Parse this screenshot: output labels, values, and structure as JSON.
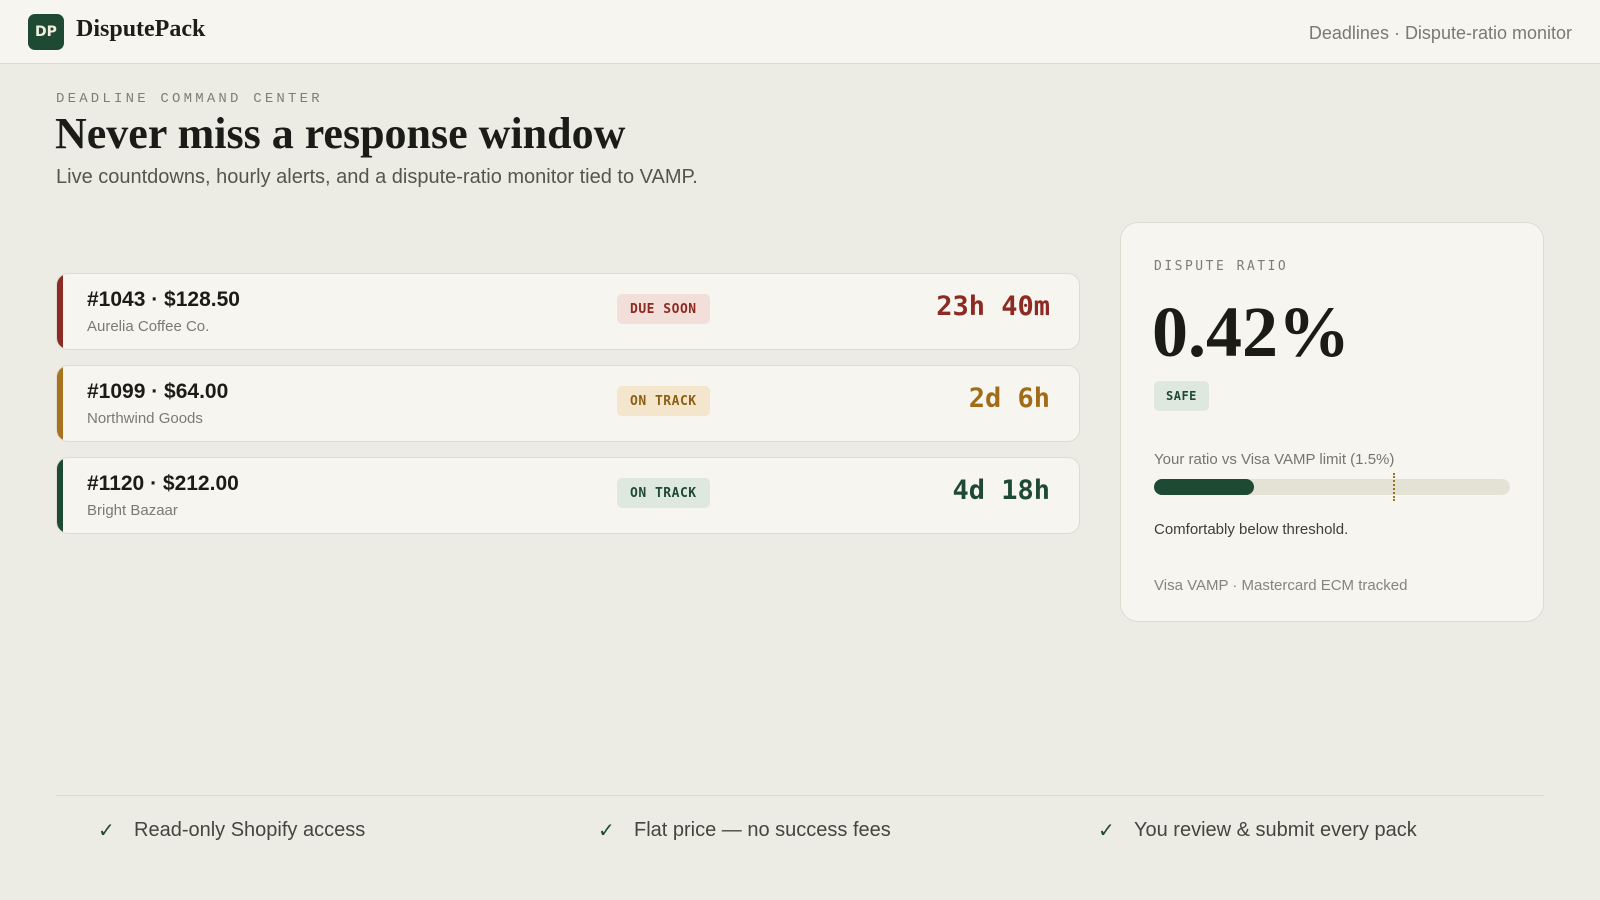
{
  "header": {
    "logo_text": "DP",
    "brand": "DisputePack",
    "nav_text": "Deadlines · Dispute-ratio monitor"
  },
  "hero": {
    "eyebrow": "DEADLINE COMMAND CENTER",
    "headline": "Never miss a response window",
    "subhead": "Live countdowns, hourly alerts, and a dispute-ratio monitor tied to VAMP."
  },
  "disputes": [
    {
      "title": "#1043 · $128.50",
      "merchant": "Aurelia Coffee Co.",
      "status": "DUE SOON",
      "countdown": "23h 40m",
      "tone": "red"
    },
    {
      "title": "#1099 · $64.00",
      "merchant": "Northwind Goods",
      "status": "ON TRACK",
      "countdown": "2d 6h",
      "tone": "amber"
    },
    {
      "title": "#1120 · $212.00",
      "merchant": "Bright Bazaar",
      "status": "ON TRACK",
      "countdown": "4d 18h",
      "tone": "green"
    }
  ],
  "ratio": {
    "label": "DISPUTE RATIO",
    "value": "0.42%",
    "badge": "SAFE",
    "compare_label": "Your ratio vs Visa VAMP limit (1.5%)",
    "ratio_percent": 0.42,
    "scale_max_percent": 1.5,
    "bar_fill_fraction": 0.28,
    "limit_marker_fraction": 0.67,
    "note": "Comfortably below threshold.",
    "footnote": "Visa VAMP · Mastercard ECM tracked"
  },
  "features": [
    {
      "icon": "check-icon",
      "label": "Read-only Shopify access"
    },
    {
      "icon": "check-icon",
      "label": "Flat price — no success fees"
    },
    {
      "icon": "check-icon",
      "label": "You review & submit every pack"
    }
  ],
  "colors": {
    "brand_green": "#1e4a33",
    "due_soon_red": "#8c2a23",
    "on_track_amber": "#a06c18",
    "background": "#edece4"
  }
}
